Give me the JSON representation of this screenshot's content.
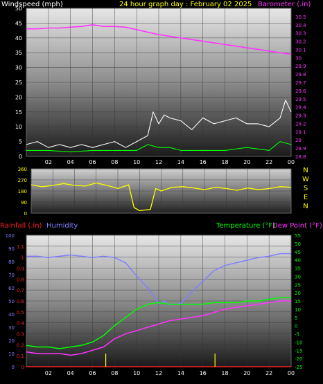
{
  "header": {
    "windspeed_label": "Windspeed (mph)",
    "title": "24 hour graph day : February 02 2025",
    "barometer_label": "Barometer (.in)"
  },
  "lower_header": {
    "rainfall_label": "Rainfall (.in)",
    "humidity_label": "Humidity",
    "temperature_label": "Temperature (°F)",
    "dewpoint_label": "Dew Point (°F)"
  },
  "direction_labels": [
    "N",
    "W",
    "S",
    "E",
    "N"
  ],
  "colors": {
    "windspeed": "#ffffff",
    "wind_avg": "#00ff00",
    "barometer": "#ff33ff",
    "direction": "#ffff00",
    "rainfall": "#ff2222",
    "humidity": "#8080ff",
    "temperature": "#00ff00",
    "dewpoint": "#ff33ff",
    "rain_rate": "#ffff00",
    "title": "#ffff00"
  },
  "chart_data": [
    {
      "type": "line",
      "name": "wind-barometer",
      "x_tick_labels": [
        "02",
        "04",
        "06",
        "08",
        "10",
        "12",
        "14",
        "16",
        "18",
        "20",
        "22",
        "00"
      ],
      "ylim_left": [
        0,
        50
      ],
      "yticks_left": [
        0,
        5,
        10,
        15,
        20,
        25,
        30,
        35,
        40,
        45,
        50
      ],
      "ylim_right": [
        28.8,
        30.6
      ],
      "yticks_right": [
        "28.8",
        "28.9",
        "29",
        "29.1",
        "29.2",
        "29.3",
        "29.4",
        "29.5",
        "29.6",
        "29.7",
        "29.8",
        "29.9",
        "30",
        "30.1",
        "30.2",
        "30.3",
        "30.4",
        "30.5"
      ],
      "barometer": {
        "x": [
          0,
          1,
          2,
          3,
          4,
          5,
          6,
          7,
          8,
          9,
          10,
          11,
          12,
          13,
          14,
          15,
          16,
          17,
          18,
          19,
          20,
          21,
          22,
          23,
          24
        ],
        "values": [
          30.35,
          30.35,
          30.36,
          30.36,
          30.37,
          30.38,
          30.4,
          30.38,
          30.38,
          30.37,
          30.34,
          30.31,
          30.28,
          30.26,
          30.24,
          30.22,
          30.2,
          30.18,
          30.16,
          30.14,
          30.12,
          30.1,
          30.08,
          30.06,
          30.04
        ]
      },
      "wind_gust": {
        "x": [
          0,
          1,
          2,
          3,
          4,
          5,
          6,
          7,
          8,
          9,
          10,
          11,
          11.5,
          12,
          12.5,
          13,
          14,
          15,
          16,
          17,
          18,
          19,
          20,
          21,
          22,
          23,
          23.5,
          24
        ],
        "values": [
          4,
          5,
          3,
          4,
          3,
          4,
          3,
          4,
          5,
          3,
          5,
          7,
          15,
          11,
          14,
          13,
          12,
          9,
          13,
          11,
          12,
          13,
          11,
          11,
          10,
          13,
          19,
          15
        ]
      },
      "wind_avg": {
        "x": [
          0,
          2,
          4,
          6,
          8,
          10,
          11,
          12,
          13,
          14,
          16,
          18,
          20,
          22,
          23,
          24
        ],
        "values": [
          2,
          2,
          1.5,
          2,
          2,
          2,
          4,
          3,
          3,
          2,
          2,
          2,
          3,
          2,
          5,
          4
        ]
      }
    },
    {
      "type": "line",
      "name": "wind-direction",
      "ylim": [
        0,
        360
      ],
      "yticks": [
        0,
        90,
        180,
        270,
        360
      ],
      "x": [
        0,
        1,
        2,
        3,
        4,
        5,
        6,
        7,
        8,
        9,
        9.5,
        10,
        11,
        11.5,
        12,
        13,
        14,
        15,
        16,
        17,
        18,
        19,
        20,
        21,
        22,
        23,
        24
      ],
      "values": [
        230,
        215,
        225,
        240,
        225,
        220,
        245,
        225,
        200,
        230,
        45,
        20,
        30,
        200,
        180,
        210,
        215,
        205,
        190,
        210,
        200,
        185,
        205,
        190,
        200,
        215,
        210
      ]
    },
    {
      "type": "line",
      "name": "rain-humidity-temperature",
      "x_tick_labels": [
        "02",
        "04",
        "06",
        "08",
        "10",
        "12",
        "14",
        "16",
        "18",
        "20",
        "22",
        "00"
      ],
      "ylim_rainfall": [
        0,
        1.2
      ],
      "yticks_rainfall": [
        "0",
        "0.1",
        "0.2",
        "0.3",
        "0.4",
        "0.5",
        "0.6",
        "0.7",
        "0.8",
        "0.9",
        "1",
        "1.1"
      ],
      "ylim_humidity": [
        0,
        100
      ],
      "yticks_humidity": [
        0,
        10,
        20,
        30,
        40,
        50,
        60,
        70,
        80,
        90,
        100
      ],
      "ylim_temp": [
        -25,
        55
      ],
      "yticks_temp": [
        -25,
        -20,
        -15,
        -10,
        -5,
        0,
        5,
        10,
        15,
        20,
        25,
        30,
        35,
        40,
        45,
        50,
        55
      ],
      "humidity": {
        "x": [
          0,
          1,
          2,
          3,
          4,
          5,
          6,
          7,
          8,
          9,
          10,
          11,
          11.5,
          12,
          12.5,
          13,
          14,
          15,
          16,
          17,
          18,
          19,
          20,
          21,
          22,
          23,
          24
        ],
        "values": [
          84,
          84,
          83,
          84,
          85,
          84,
          83,
          84,
          83,
          79,
          69,
          60,
          55,
          48,
          50,
          47,
          48,
          57,
          65,
          73,
          77,
          79,
          81,
          83,
          84,
          86,
          86
        ]
      },
      "temperature": {
        "x": [
          0,
          1,
          2,
          3,
          4,
          5,
          6,
          7,
          8,
          9,
          10,
          11,
          12,
          13,
          14,
          15,
          16,
          17,
          18,
          19,
          20,
          21,
          22,
          23,
          24
        ],
        "values": [
          -12,
          -13,
          -13,
          -14,
          -13,
          -12,
          -10,
          -6,
          0,
          5,
          10,
          13,
          14,
          13,
          13,
          13,
          13,
          14,
          14,
          14,
          15,
          15,
          16,
          17,
          17
        ]
      },
      "dewpoint": {
        "x": [
          0,
          1,
          2,
          3,
          4,
          5,
          6,
          7,
          8,
          9,
          10,
          11,
          12,
          13,
          14,
          15,
          16,
          17,
          18,
          19,
          20,
          21,
          22,
          23,
          24
        ],
        "values": [
          -16,
          -17,
          -17,
          -17,
          -18,
          -17,
          -15,
          -13,
          -8,
          -5,
          -3,
          -1,
          1,
          3,
          4,
          5,
          6,
          8,
          10,
          11,
          12,
          13,
          14,
          15,
          15
        ]
      },
      "rainfall": {
        "x": [
          0,
          24
        ],
        "values": [
          0,
          0
        ]
      },
      "rain_rate_marks": {
        "x": [
          7.2,
          17.1
        ],
        "values": [
          0.12,
          0.12
        ]
      }
    }
  ]
}
